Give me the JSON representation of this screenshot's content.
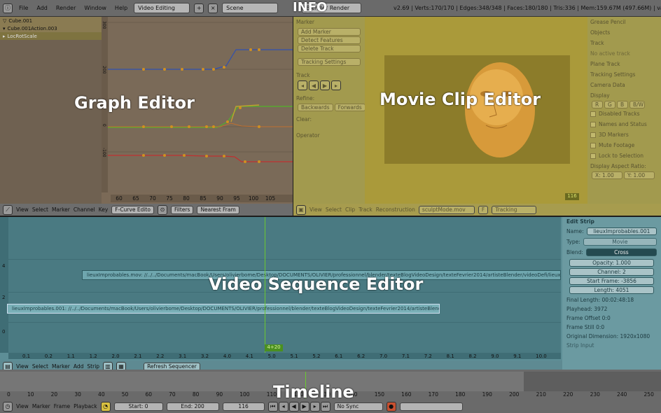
{
  "labels": {
    "info": "INFO",
    "graph": "Graph Editor",
    "clip": "Movie Clip Editor",
    "vse": "Video Sequence Editor",
    "timeline": "Timeline"
  },
  "info": {
    "menus": [
      "File",
      "Add",
      "Render",
      "Window",
      "Help"
    ],
    "screen": "Video Editing",
    "scene": "Scene",
    "engine": "Blender Render",
    "stats": "v2.69 | Verts:170/170 | Edges:348/348 | Faces:180/180 | Tris:336 | Mem:159.67M (497.66M) | vaseterre"
  },
  "graph": {
    "outliner": [
      "Cube.001",
      "Cube.001Action.003",
      "LocRotScale"
    ],
    "yticks": [
      "300",
      "200",
      "100",
      "0",
      "-100",
      "-200"
    ],
    "xticks": [
      "60",
      "65",
      "70",
      "75",
      "80",
      "85",
      "90",
      "95",
      "100",
      "105"
    ],
    "header": {
      "menus": [
        "View",
        "Select",
        "Marker",
        "Channel",
        "Key"
      ],
      "mode": "F-Curve Edito",
      "filters": "Filters",
      "pivot": "Nearest Fram"
    }
  },
  "clip": {
    "left_panel": {
      "marker": "Marker",
      "add": "Add Marker",
      "detect": "Detect Features",
      "delete": "Delete Track",
      "settings": "Tracking Settings",
      "track": "Track",
      "refine": "Refine:",
      "backwards": "Backwards",
      "forwards": "Forwards",
      "clear": "Clear:",
      "operator": "Operator"
    },
    "right_panel": {
      "grease": "Grease Pencil",
      "objects": "Objects",
      "track": "Track",
      "noactive": "No active track",
      "planetrack": "Plane Track",
      "tracksettings": "Tracking Settings",
      "cameradata": "Camera Data",
      "display": "Display",
      "r": "R",
      "g": "G",
      "b": "B",
      "bw": "B/W",
      "disabled": "Disabled Tracks",
      "names": "Names and Status",
      "markers3d": "3D Markers",
      "mute": "Mute Footage",
      "lock": "Lock to Selection",
      "aspect": "Display Aspect Ratio:",
      "x": "X: 1.00",
      "y": "Y: 1.00"
    },
    "frame": "116",
    "header": {
      "menus": [
        "View",
        "Select",
        "Clip",
        "Track",
        "Reconstruction"
      ],
      "file": "sculptMode.mov",
      "f": "F",
      "mode": "Tracking"
    }
  },
  "vse": {
    "strip1": "lieuxImprobables.mov: //../../Documents/macBook/Users/olivierbome/Desktop/DOCUMENTS/OLIVIER/professionnel/blender/texteBlogVideoDesign/texteFevrier2014/artisteBlender/videoDefi/lieuxImprobables",
    "strip2": "lieuxImprobables.001: //../../Documents/macBook/Users/olivierbome/Desktop/DOCUMENTS/OLIVIER/professionnel/blender/texteBlogVideoDesign/texteFevrier2014/artisteBlender/video",
    "yticks": [
      "4",
      "2",
      "0"
    ],
    "xticks": [
      "0.1",
      "0.2",
      "1.1",
      "1.2",
      "2.0",
      "2.1",
      "2.2",
      "3.1",
      "3.2",
      "4.0",
      "4.1",
      "5.0",
      "5.1",
      "5.2",
      "6.1",
      "6.2",
      "7.0",
      "7.1",
      "7.2",
      "8.1",
      "8.2",
      "9.0",
      "9.1",
      "10.0"
    ],
    "cursor": "4+20",
    "side": {
      "title": "Edit Strip",
      "name_label": "Name:",
      "name": "lieuxImprobables.001",
      "type_label": "Type:",
      "type": "Movie",
      "blend_label": "Blend:",
      "blend": "Cross",
      "opacity": "Opacity: 1.000",
      "channel": "Channel: 2",
      "start": "Start Frame: -3856",
      "length": "Length: 4051",
      "final": "Final Length: 00:02:48:18",
      "playhead": "Playhead: 3972",
      "offset": "Frame Offset 0:0",
      "still": "Frame Still 0:0",
      "dim": "Original Dimension: 1920x1080",
      "input": "Strip Input"
    },
    "header": {
      "menus": [
        "View",
        "Select",
        "Marker",
        "Add",
        "Strip"
      ],
      "refresh": "Refresh Sequencer"
    }
  },
  "timeline": {
    "ticks": [
      "0",
      "10",
      "20",
      "30",
      "40",
      "50",
      "60",
      "70",
      "80",
      "90",
      "100",
      "110",
      "120",
      "130",
      "140",
      "150",
      "160",
      "170",
      "180",
      "190",
      "200",
      "210",
      "220",
      "230",
      "240",
      "250"
    ],
    "header": {
      "menus": [
        "View",
        "Marker",
        "Frame",
        "Playback"
      ],
      "start": "Start: 0",
      "end": "End: 200",
      "current": "116",
      "sync": "No Sync"
    }
  }
}
